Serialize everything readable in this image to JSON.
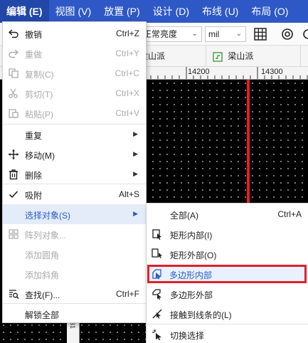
{
  "menubar": {
    "items": [
      {
        "label": "编辑 (E)",
        "active": true
      },
      {
        "label": "视图 (V)"
      },
      {
        "label": "放置 (P)"
      },
      {
        "label": "设计 (D)"
      },
      {
        "label": "布线 (U)"
      },
      {
        "label": "布局 (O)"
      }
    ]
  },
  "toolbar": {
    "brightness_value": "正常亮度",
    "unit_value": "mil"
  },
  "tabs": [
    {
      "label": "梁山派"
    },
    {
      "label": "梁山派"
    }
  ],
  "ruler": {
    "labels": [
      "14200",
      "14300"
    ]
  },
  "vruler": {
    "label": "31"
  },
  "edit_menu": {
    "items": [
      {
        "label": "撤销",
        "shortcut": "Ctrl+Z",
        "icon": "undo-icon"
      },
      {
        "label": "重做",
        "shortcut": "Ctrl+Y",
        "icon": "redo-icon",
        "disabled": true
      },
      {
        "label": "复制(C)",
        "shortcut": "Ctrl+C",
        "icon": "copy-icon",
        "disabled": true
      },
      {
        "label": "剪切(T)",
        "shortcut": "Ctrl+X",
        "icon": "scissors-icon",
        "disabled": true
      },
      {
        "label": "粘贴(P)",
        "shortcut": "Ctrl+V",
        "icon": "paste-icon",
        "disabled": true
      },
      {
        "label": "重复",
        "submenu": true
      },
      {
        "label": "移动(M)",
        "submenu": true,
        "icon": "move-icon"
      },
      {
        "label": "删除",
        "submenu": true,
        "icon": "trash-icon"
      },
      {
        "label": "吸附",
        "shortcut": "Alt+S",
        "icon": "check-icon",
        "checked": true
      },
      {
        "label": "选择对象(S)",
        "submenu": true,
        "hover": true
      },
      {
        "label": "阵列对象...",
        "icon": "grid-array-icon",
        "disabled": true
      },
      {
        "label": "添加圆角",
        "disabled": true
      },
      {
        "label": "添加斜角",
        "disabled": true
      },
      {
        "label": "查找(F)...",
        "shortcut": "Ctrl+F",
        "icon": "find-icon"
      },
      {
        "label": "解锁全部"
      }
    ]
  },
  "select_submenu": {
    "items": [
      {
        "label": "全部(A)",
        "shortcut": "Ctrl+A"
      },
      {
        "label": "矩形内部(I)",
        "icon": "rect-inside-icon"
      },
      {
        "label": "矩形外部(O)",
        "icon": "rect-outside-icon"
      },
      {
        "label": "多边形内部",
        "icon": "polygon-inside-icon",
        "highlighted": true
      },
      {
        "label": "多边形外部",
        "icon": "polygon-outside-icon"
      },
      {
        "label": "接触到线条的(L)",
        "icon": "touch-line-icon"
      },
      {
        "label": "切换选择",
        "icon": "toggle-select-icon"
      }
    ]
  },
  "colors": {
    "menubar": "#2e58c6",
    "accent_text": "#2b5bc7",
    "highlight_border": "#e0202a",
    "canvas": "#000000",
    "trace": "#e51f1f"
  }
}
